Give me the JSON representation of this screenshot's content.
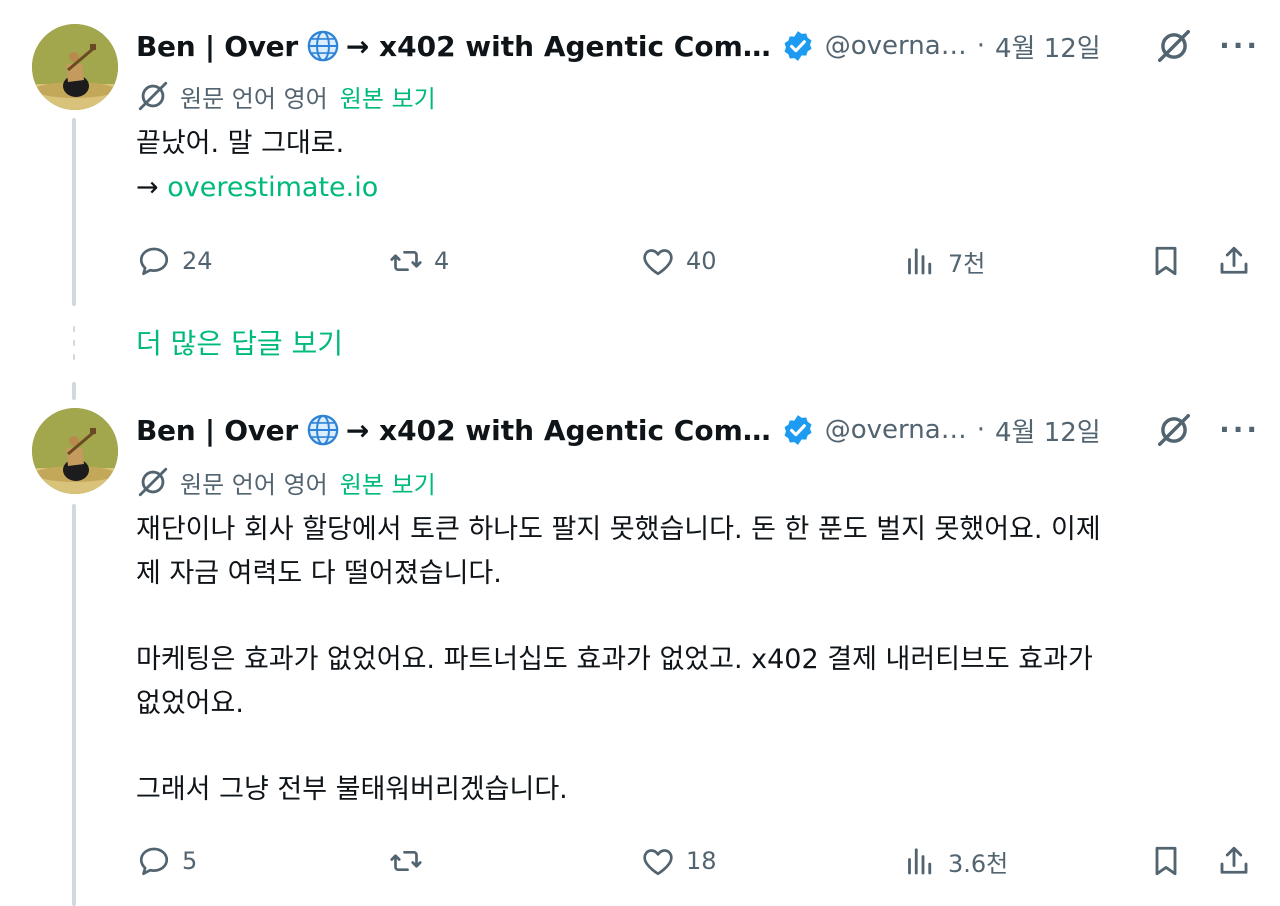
{
  "colors": {
    "accent": "#00ba7c",
    "muted": "#536471",
    "text": "#0f1419",
    "verified": "#1d9bf0",
    "line": "#cfd9de"
  },
  "tweets": [
    {
      "name": "Ben | Over",
      "name_suffix": "→ x402 with Agentic Com…",
      "handle": "@overna…",
      "separator": "·",
      "date": "4월 12일",
      "translate_label": "원문 언어 영어",
      "show_original": "원본 보기",
      "lines": [
        "끝났어. 말 그대로."
      ],
      "link_prefix": "→ ",
      "link_text": "overestimate.io",
      "replies": "24",
      "retweets": "4",
      "likes": "40",
      "views": "7천"
    },
    {
      "name": "Ben | Over",
      "name_suffix": "→ x402 with Agentic Com…",
      "handle": "@overna…",
      "separator": "·",
      "date": "4월 12일",
      "translate_label": "원문 언어 영어",
      "show_original": "원본 보기",
      "lines": [
        "재단이나 회사 할당에서 토큰 하나도 팔지 못했습니다. 돈 한 푼도 벌지 못했어요. 이제",
        "제 자금 여력도 다 떨어졌습니다.",
        "마케팅은 효과가 없었어요. 파트너십도 효과가 없었고. x402 결제 내러티브도 효과가",
        "없었어요.",
        "그래서 그냥 전부 불태워버리겠습니다."
      ],
      "replies": "5",
      "retweets": "",
      "likes": "18",
      "views": "3.6천"
    }
  ],
  "show_more_replies": "더 많은 답글 보기",
  "icons": [
    "globe-icon",
    "verified-badge-icon",
    "grok-icon",
    "more-icon",
    "translate-icon",
    "reply-icon",
    "retweet-icon",
    "like-icon",
    "views-icon",
    "bookmark-icon",
    "share-icon"
  ]
}
